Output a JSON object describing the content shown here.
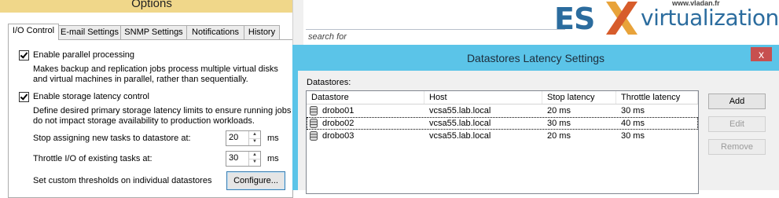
{
  "options": {
    "title": "Options",
    "tabs": [
      "I/O Control",
      "E-mail Settings",
      "SNMP Settings",
      "Notifications",
      "History"
    ],
    "parallel": {
      "label": "Enable parallel processing",
      "desc1": "Makes backup and replication jobs process multiple virtual disks",
      "desc2": "and virtual machines in parallel, rather than sequentially."
    },
    "latency": {
      "label": "Enable storage latency control",
      "desc1": "Define desired primary storage latency limits to ensure running jobs",
      "desc2": "do not impact storage availability to production workloads."
    },
    "stop_assign": {
      "label": "Stop assigning new tasks to datastore at:",
      "value": "20",
      "unit": "ms"
    },
    "throttle": {
      "label": "Throttle I/O of existing tasks at:",
      "value": "30",
      "unit": "ms"
    },
    "custom": {
      "label": "Set custom thresholds on individual datastores",
      "button": "Configure..."
    }
  },
  "background": {
    "search_placeholder": "search for"
  },
  "logo": {
    "site": "www.vladan.fr",
    "es": "ES",
    "virt": "virtualization"
  },
  "dialog": {
    "title": "Datastores Latency Settings",
    "close": "x",
    "datastores_label": "Datastores:",
    "columns": [
      "Datastore",
      "Host",
      "Stop latency",
      "Throttle latency"
    ],
    "rows": [
      {
        "datastore": "drobo01",
        "host": "vcsa55.lab.local",
        "stop": "20 ms",
        "throttle": "30 ms"
      },
      {
        "datastore": "drobo02",
        "host": "vcsa55.lab.local",
        "stop": "30 ms",
        "throttle": "40 ms"
      },
      {
        "datastore": "drobo03",
        "host": "vcsa55.lab.local",
        "stop": "20 ms",
        "throttle": "30 ms"
      }
    ],
    "buttons": {
      "add": "Add",
      "edit": "Edit",
      "remove": "Remove"
    }
  }
}
